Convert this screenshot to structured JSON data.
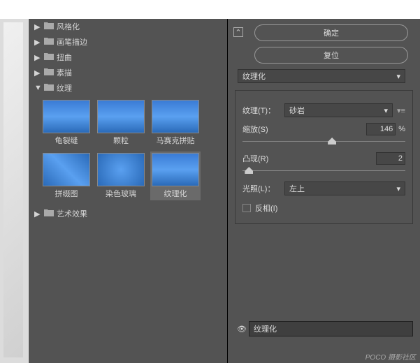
{
  "categories": [
    {
      "label": "风格化",
      "open": false
    },
    {
      "label": "画笔描边",
      "open": false
    },
    {
      "label": "扭曲",
      "open": false
    },
    {
      "label": "素描",
      "open": false
    },
    {
      "label": "纹理",
      "open": true
    },
    {
      "label": "艺术效果",
      "open": false
    }
  ],
  "thumbs": [
    {
      "label": "龟裂缝",
      "selected": false
    },
    {
      "label": "颗粒",
      "selected": false
    },
    {
      "label": "马赛克拼贴",
      "selected": false
    },
    {
      "label": "拼缀图",
      "selected": false
    },
    {
      "label": "染色玻璃",
      "selected": false
    },
    {
      "label": "纹理化",
      "selected": true
    }
  ],
  "buttons": {
    "ok": "确定",
    "reset": "复位"
  },
  "filter_select": "纹理化",
  "controls": {
    "texture": {
      "label": "纹理(T)：",
      "value": "砂岩"
    },
    "scale": {
      "label": "缩放(S)",
      "value": "146",
      "suffix": "%",
      "pos": 55
    },
    "relief": {
      "label": "凸现(R)",
      "value": "2",
      "pos": 4
    },
    "light": {
      "label": "光照(L)：",
      "value": "左上"
    },
    "invert": {
      "label": "反相(I)",
      "checked": false
    }
  },
  "stack": {
    "item": "纹理化"
  },
  "watermark": "POCO 摄影社区",
  "glyphs": {
    "tri_right": "▶",
    "tri_down": "▼",
    "chev_down": "▾",
    "chev_up": "⌃",
    "eye": "👁",
    "menu": "▾≡"
  }
}
